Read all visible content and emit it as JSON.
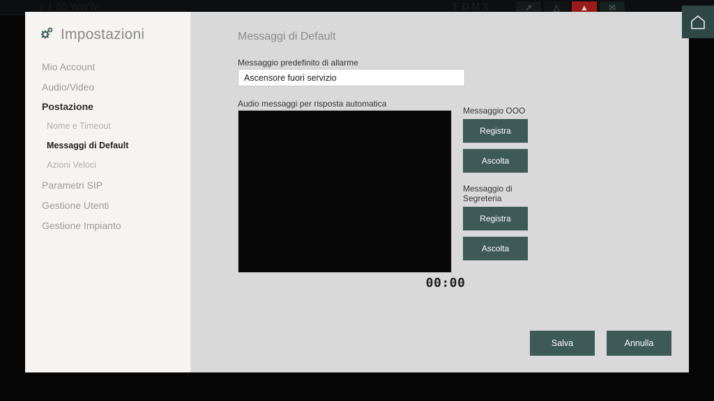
{
  "background": {
    "window_title": "1 1  50  WWW",
    "brand": "FDMX",
    "icons": [
      {
        "name": "chart-icon",
        "glyph": "↗"
      },
      {
        "name": "bell-icon",
        "glyph": "△"
      },
      {
        "name": "alert-icon",
        "glyph": "▲"
      },
      {
        "name": "mail-icon",
        "glyph": "✉"
      }
    ]
  },
  "home_button": {
    "icon": "home-icon"
  },
  "sidebar": {
    "title": "Impostazioni",
    "icon": "gear-icon",
    "items": [
      {
        "label": "Mio Account",
        "level": "top",
        "active": false
      },
      {
        "label": "Audio/Video",
        "level": "top",
        "active": false
      },
      {
        "label": "Postazione",
        "level": "top",
        "active": true
      },
      {
        "label": "Nome e Timeout",
        "level": "sub",
        "active": false
      },
      {
        "label": "Messaggi di Default",
        "level": "sub",
        "active": true
      },
      {
        "label": "Azioni Veloci",
        "level": "sub",
        "active": false
      },
      {
        "label": "Parametri SIP",
        "level": "top",
        "active": false
      },
      {
        "label": "Gestione Utenti",
        "level": "top",
        "active": false
      },
      {
        "label": "Gestione Impianto",
        "level": "top",
        "active": false
      }
    ]
  },
  "main": {
    "page_title": "Messaggi di Default",
    "alarm": {
      "label": "Messaggio predefinito di allarme",
      "value": "Ascensore fuori servizio",
      "placeholder": "Messaggio predefinito di allarme"
    },
    "audio": {
      "label": "Audio messaggi per risposta automatica",
      "timer": "00:00"
    },
    "groups": [
      {
        "label": "Messaggio OOO",
        "record_label": "Registra",
        "listen_label": "Ascolta"
      },
      {
        "label": "Messaggio di Segreteria",
        "record_label": "Registra",
        "listen_label": "Ascolta"
      }
    ]
  },
  "footer": {
    "save_label": "Salva",
    "cancel_label": "Annulla"
  },
  "colors": {
    "button": "#3d5a57",
    "home_button": "#2f4845",
    "dialog_bg": "#d9d9d9",
    "sidebar_bg": "#f5f4f2",
    "alert": "#9b1b1b"
  }
}
